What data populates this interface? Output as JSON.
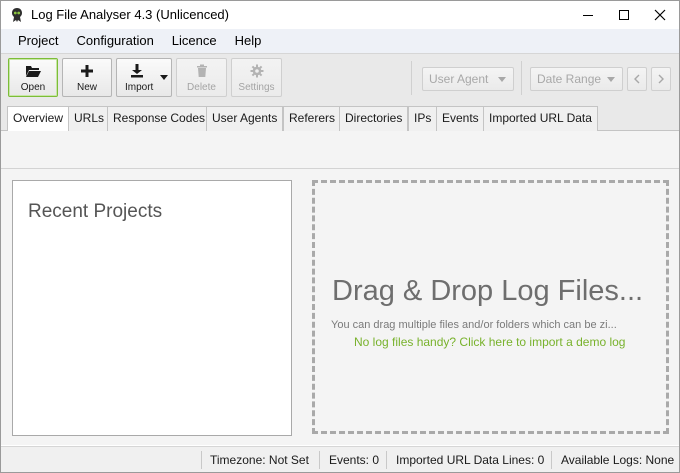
{
  "window": {
    "title": "Log File Analyser 4.3 (Unlicenced)",
    "controls": [
      "minimize-icon",
      "maximize-icon",
      "close-icon"
    ]
  },
  "menu": {
    "items": [
      "Project",
      "Configuration",
      "Licence",
      "Help"
    ]
  },
  "toolbar": {
    "open_label": "Open",
    "new_label": "New",
    "import_label": "Import",
    "delete_label": "Delete",
    "settings_label": "Settings",
    "user_agent_label": "User Agent",
    "date_range_label": "Date Range"
  },
  "tabs": [
    "Overview",
    "URLs",
    "Response Codes",
    "User Agents",
    "Referers",
    "Directories",
    "IPs",
    "Events",
    "Imported URL Data"
  ],
  "selected_tab": "Overview",
  "recent_projects": {
    "title": "Recent Projects"
  },
  "drop_zone": {
    "title": "Drag & Drop Log Files...",
    "subtitle": "You can drag multiple files and/or folders which can be zi...",
    "demo_link": "No log files handy? Click here to import a demo log"
  },
  "status": {
    "timezone": "Timezone:  Not Set",
    "events": "Events:  0",
    "imported_lines": "Imported URL Data Lines:  0",
    "available_logs": "Available Logs:  None"
  },
  "colors": {
    "accent_green": "#78b22c",
    "active_button_border": "#7cbd38"
  }
}
